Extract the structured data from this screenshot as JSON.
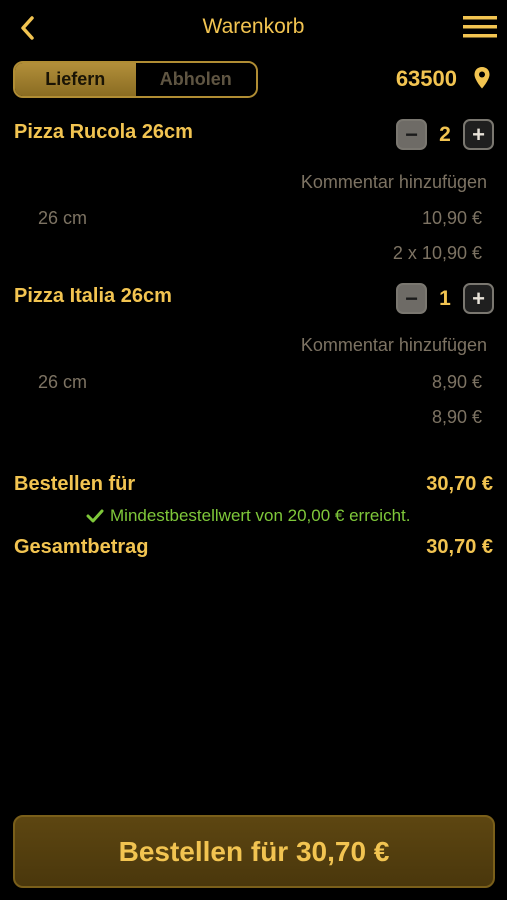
{
  "header": {
    "title": "Warenkorb",
    "back_icon": "chevron-left-icon",
    "menu_icon": "hamburger-icon"
  },
  "delivery": {
    "tabs": [
      "Liefern",
      "Abholen"
    ],
    "active": "Liefern",
    "zip": "63500",
    "location_icon": "map-pin-icon"
  },
  "items": [
    {
      "name": "Pizza Rucola 26cm",
      "qty": "2",
      "comment": "Kommentar hinzufügen",
      "variant": "26 cm",
      "unit_price": "10,90 €",
      "line_total": "2 x 10,90 €"
    },
    {
      "name": "Pizza Italia 26cm",
      "qty": "1",
      "comment": "Kommentar hinzufügen",
      "variant": "26 cm",
      "unit_price": "8,90 €",
      "line_total": "8,90 €"
    }
  ],
  "summary": {
    "order_for_label": "Bestellen für",
    "order_for_value": "30,70 €",
    "min_note": "Mindestbestellwert von 20,00 € erreicht.",
    "total_label": "Gesamtbetrag",
    "total_value": "30,70 €"
  },
  "cta": {
    "label": "Bestellen für 30,70 €"
  },
  "colors": {
    "accent": "#f2c451",
    "muted": "#7d7363",
    "success": "#7fc83a",
    "background": "#000000"
  }
}
